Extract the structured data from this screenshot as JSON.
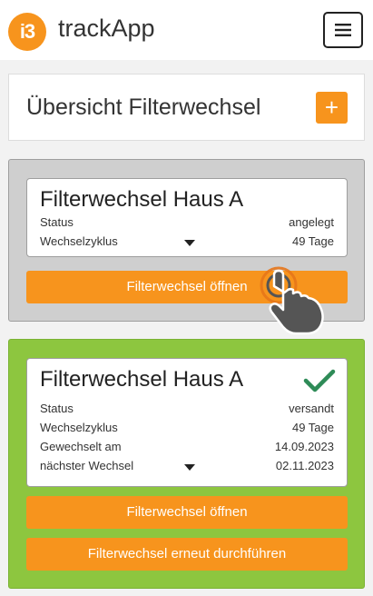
{
  "app": {
    "logo_text": "i3",
    "title": "trackApp"
  },
  "header": {
    "menu_icon": "hamburger-menu-icon"
  },
  "overview": {
    "title": "Übersicht Filterwechsel",
    "add_icon": "plus-icon",
    "add_label": "+"
  },
  "cards": [
    {
      "title": "Filterwechsel Haus A",
      "panel_color": "#cfcfcf",
      "rows": [
        {
          "label": "Status",
          "value": "angelegt"
        },
        {
          "label": "Wechselzyklus",
          "value": "49 Tage"
        }
      ],
      "buttons": [
        "Filterwechsel öffnen"
      ]
    },
    {
      "title": "Filterwechsel Haus A",
      "panel_color": "#8dc63f",
      "check_icon": "checkmark-icon",
      "rows": [
        {
          "label": "Status",
          "value": "versandt"
        },
        {
          "label": "Wechselzyklus",
          "value": "49 Tage"
        },
        {
          "label": "Gewechselt am",
          "value": "14.09.2023"
        },
        {
          "label": "nächster Wechsel",
          "value": "02.11.2023"
        }
      ],
      "buttons": [
        "Filterwechsel öffnen",
        "Filterwechsel erneut durchführen"
      ]
    }
  ],
  "colors": {
    "accent": "#f7941d",
    "status_done": "#8dc63f",
    "status_pending": "#cfcfcf",
    "check": "#2e8b57"
  },
  "overlay": {
    "cursor_icon": "tap-hand-icon"
  }
}
